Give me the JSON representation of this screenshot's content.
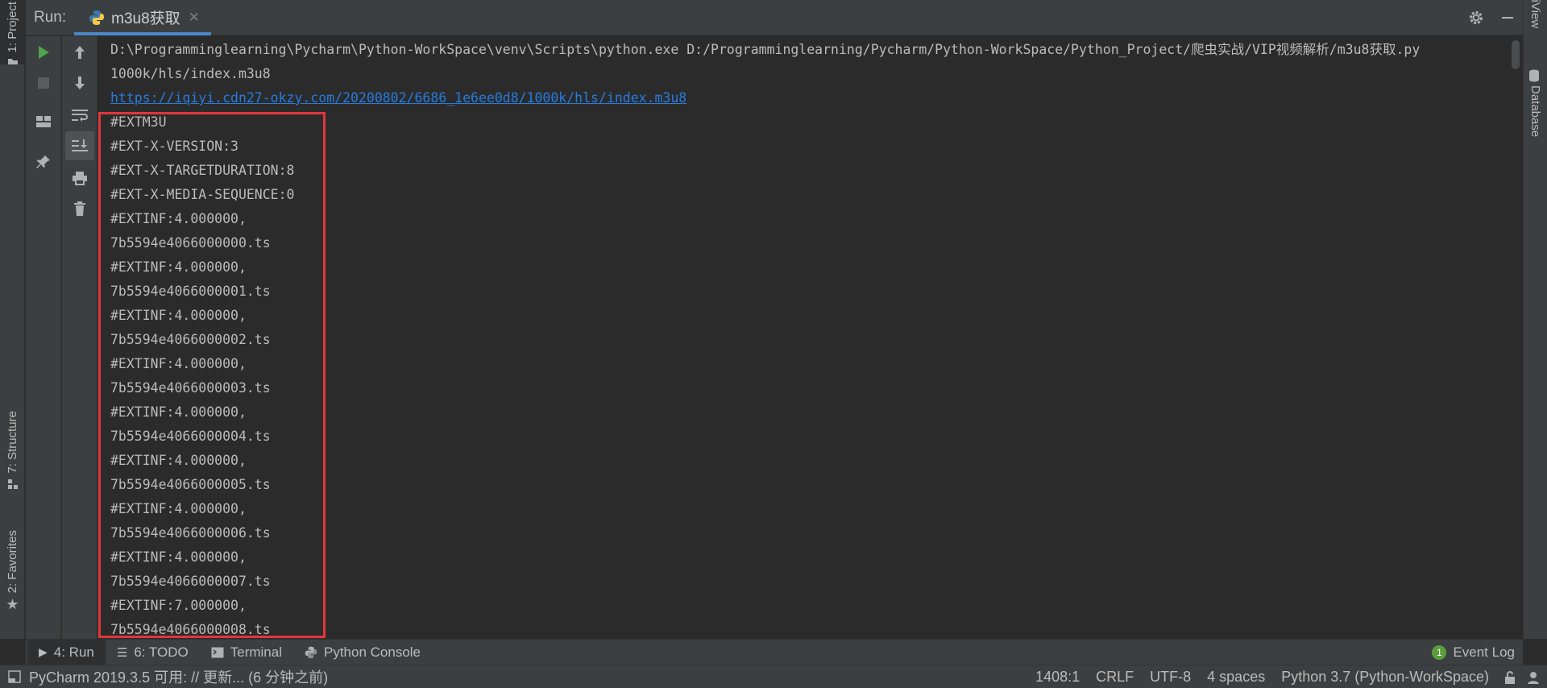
{
  "left_strip": {
    "project_tab": "1: Project",
    "structure_tab": "7: Structure",
    "favorites_tab": "2: Favorites"
  },
  "right_strip": {
    "sciview_tab": "SciView",
    "database_tab": "Database"
  },
  "run_header": {
    "label": "Run:",
    "tab_title": "m3u8获取"
  },
  "console": {
    "lines": [
      "D:\\Programminglearning\\Pycharm\\Python-WorkSpace\\venv\\Scripts\\python.exe D:/Programminglearning/Pycharm/Python-WorkSpace/Python_Project/爬虫实战/VIP视频解析/m3u8获取.py",
      "1000k/hls/index.m3u8",
      "https://iqiyi.cdn27-okzy.com/20200802/6686_1e6ee0d8/1000k/hls/index.m3u8",
      "#EXTM3U",
      "#EXT-X-VERSION:3",
      "#EXT-X-TARGETDURATION:8",
      "#EXT-X-MEDIA-SEQUENCE:0",
      "#EXTINF:4.000000,",
      "7b5594e4066000000.ts",
      "#EXTINF:4.000000,",
      "7b5594e4066000001.ts",
      "#EXTINF:4.000000,",
      "7b5594e4066000002.ts",
      "#EXTINF:4.000000,",
      "7b5594e4066000003.ts",
      "#EXTINF:4.000000,",
      "7b5594e4066000004.ts",
      "#EXTINF:4.000000,",
      "7b5594e4066000005.ts",
      "#EXTINF:4.000000,",
      "7b5594e4066000006.ts",
      "#EXTINF:4.000000,",
      "7b5594e4066000007.ts",
      "#EXTINF:7.000000,",
      "7b5594e4066000008.ts"
    ],
    "link_line_index": 2
  },
  "tool_windows": {
    "run": "4: Run",
    "todo": "6: TODO",
    "terminal": "Terminal",
    "python_console": "Python Console",
    "event_log": "Event Log",
    "event_log_count": "1"
  },
  "status_bar": {
    "message": "PyCharm 2019.3.5 可用: // 更新... (6 分钟之前)",
    "position": "1408:1",
    "line_sep": "CRLF",
    "encoding": "UTF-8",
    "indent": "4 spaces",
    "interpreter": "Python 3.7 (Python-WorkSpace)"
  },
  "colors": {
    "run_green": "#4fa34f",
    "link_blue": "#287bde",
    "highlight_red": "#e0363c"
  }
}
